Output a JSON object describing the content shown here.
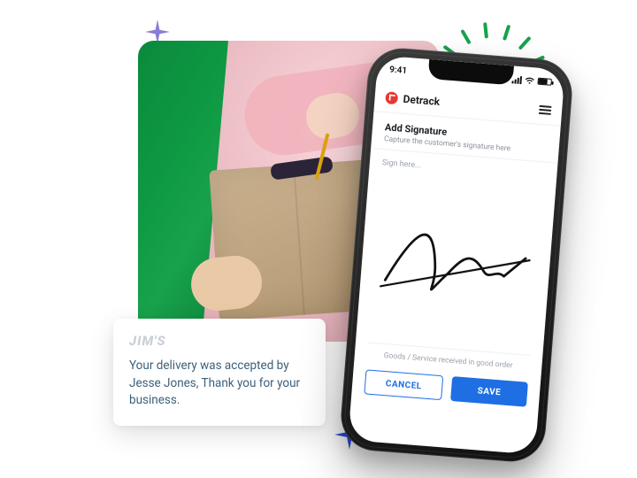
{
  "decor": {
    "sparkle_top_color": "#8a7dd6",
    "sparkle_bottom_color": "#2a4ee0",
    "radiate_color": "#18a24b"
  },
  "notification": {
    "brand": "JIM'S",
    "message": "Your delivery was accepted by Jesse Jones, Thank you for your business."
  },
  "phone": {
    "status": {
      "time": "9:41"
    },
    "app": {
      "brand": "Detrack",
      "section_title": "Add Signature",
      "section_subtitle": "Capture the customer's signature here",
      "sign_label": "Sign here...",
      "footer": "Goods / Service received in good order",
      "cancel": "CANCEL",
      "save": "SAVE"
    }
  }
}
